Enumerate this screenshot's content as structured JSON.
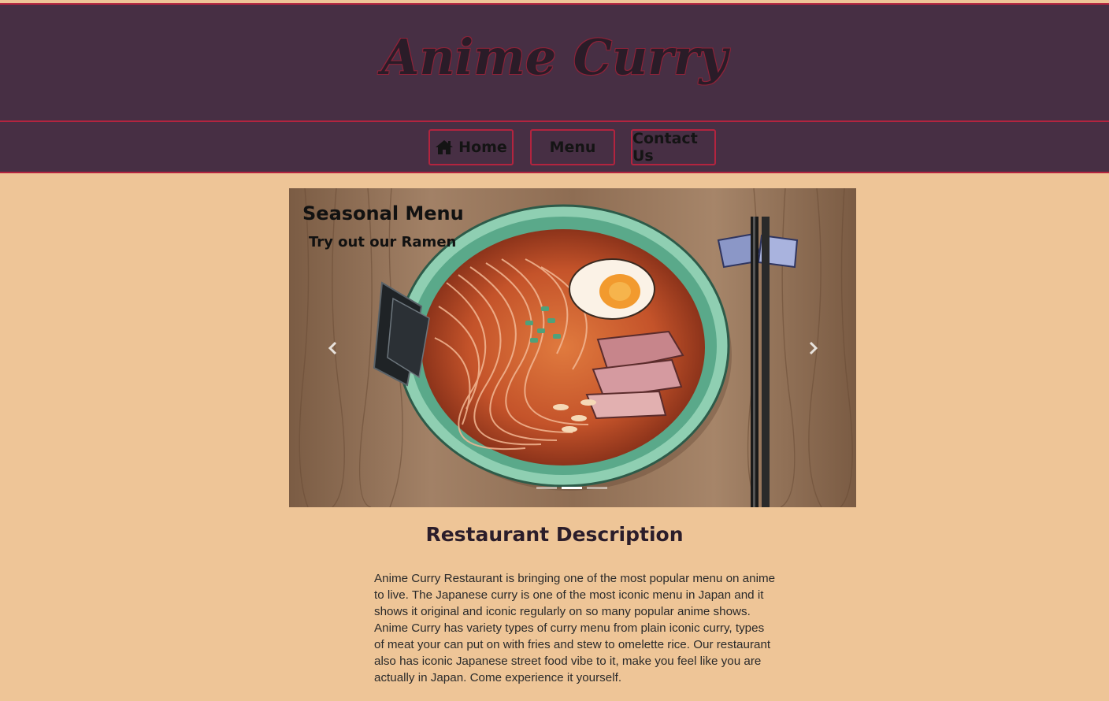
{
  "header": {
    "site_title": "Anime Curry"
  },
  "nav": {
    "items": [
      {
        "label": "Home",
        "icon": "home-icon"
      },
      {
        "label": "Menu"
      },
      {
        "label": "Contact Us"
      }
    ]
  },
  "carousel": {
    "caption_title": "Seasonal Menu",
    "caption_subtitle": "Try out our Ramen",
    "slide_count": 3,
    "active_slide": 2,
    "prev_icon": "chevron-left-icon",
    "next_icon": "chevron-right-icon"
  },
  "main": {
    "section_title": "Restaurant Description",
    "description": "Anime Curry Restaurant is bringing one of the most popular menu on anime to live. The Japanese curry is one of the most iconic menu in Japan and it shows it original and iconic regularly on so many popular anime shows. Anime Curry has variety types of curry menu from plain iconic curry, types of meat your can put on with fries and stew to omelette rice. Our restaurant also has iconic Japanese street food vibe to it, make you feel like you are actually in Japan. Come experience it yourself."
  },
  "colors": {
    "header_bg": "#472f44",
    "accent_border": "#b3243f",
    "page_bg": "#eec597"
  }
}
